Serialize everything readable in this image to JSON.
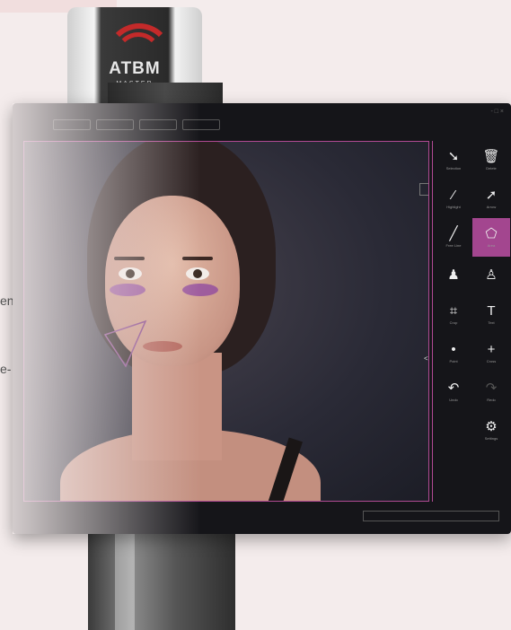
{
  "device": {
    "brand": "ATBM",
    "model": "MASTER"
  },
  "side_text": [
    "en",
    "e-"
  ],
  "toolbar": {
    "top_buttons": [
      "",
      "",
      "",
      ""
    ]
  },
  "tools": [
    {
      "icon": "cursor-icon",
      "glyph": "➘",
      "label": "Selection"
    },
    {
      "icon": "trash-icon",
      "glyph": "🗑",
      "label": "Delete"
    },
    {
      "icon": "highlight-icon",
      "glyph": "⁄",
      "label": "Highlight"
    },
    {
      "icon": "arrow-icon",
      "glyph": "➚",
      "label": "Arrow"
    },
    {
      "icon": "freeline-icon",
      "glyph": "╱",
      "label": "Free Line"
    },
    {
      "icon": "shape-icon",
      "glyph": "⬠",
      "label": "Area"
    },
    {
      "icon": "user-icon",
      "glyph": "♟",
      "label": ""
    },
    {
      "icon": "user-outline-icon",
      "glyph": "♙",
      "label": ""
    },
    {
      "icon": "crop-icon",
      "glyph": "⌗",
      "label": "Crop"
    },
    {
      "icon": "text-icon",
      "glyph": "T",
      "label": "Text"
    },
    {
      "icon": "point-icon",
      "glyph": "•",
      "label": "Point"
    },
    {
      "icon": "plus-icon",
      "glyph": "+",
      "label": "Cross"
    },
    {
      "icon": "undo-icon",
      "glyph": "↶",
      "label": "Undo"
    },
    {
      "icon": "redo-icon",
      "glyph": "↷",
      "label": "Redo"
    },
    {
      "icon": "",
      "glyph": "",
      "label": ""
    },
    {
      "icon": "settings-icon",
      "glyph": "⚙",
      "label": "Settings"
    }
  ],
  "bottom_bar": {
    "label": ""
  },
  "window_controls": "- □ ×",
  "colors": {
    "accent": "#a3468f",
    "logo_red": "#c32a2a"
  }
}
